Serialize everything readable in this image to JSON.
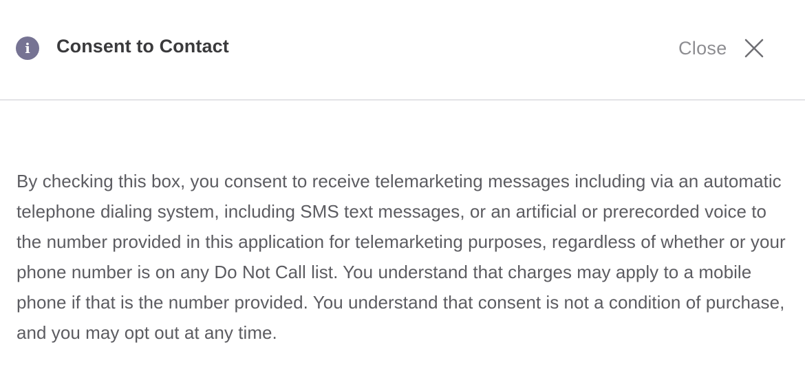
{
  "dialog": {
    "title": "Consent to Contact",
    "info_icon": "info-icon",
    "info_glyph": "i",
    "close_label": "Close",
    "close_icon": "close-icon",
    "body": "By checking this box, you consent to receive telemarketing messages including via an automatic telephone dialing system, including SMS text messages, or an artificial or prerecorded voice to the number provided in this application for telemarketing purposes, regardless of whether or your phone number is on any Do Not Call list. You understand that charges may apply to a mobile phone if that is the number provided. You understand that consent is not a condition of purchase, and you may opt out at any time."
  },
  "colors": {
    "icon_bg": "#767393",
    "title": "#3a3a3c",
    "close": "#8d8d91",
    "body_text": "#5c5c61",
    "divider": "#e3e3e6"
  }
}
